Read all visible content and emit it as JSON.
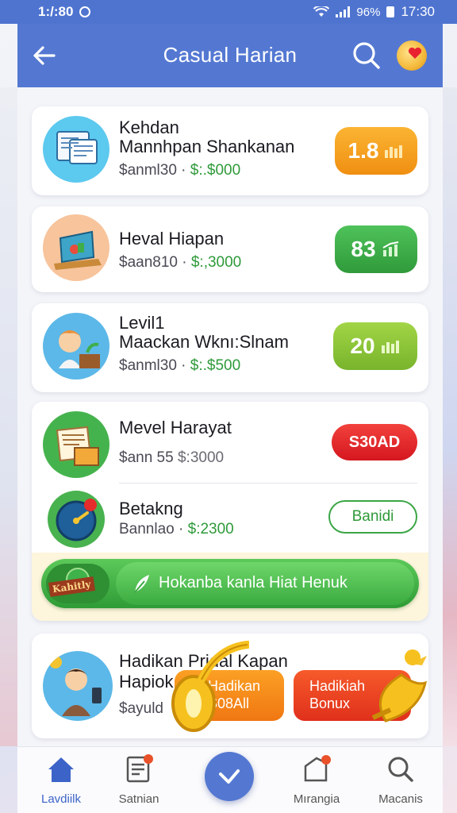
{
  "status_bar": {
    "time_left": "1:/:80",
    "battery_pct": "96%",
    "time_right": "17:30"
  },
  "header": {
    "title": "Casual Harian"
  },
  "cards": [
    {
      "title_line1": "Kehdan",
      "title_line2": "Mannhpan Shankanan",
      "sub_prefix": "$anml30 · ",
      "sub_amount": "$:.$000",
      "badge": "1.8",
      "badge_color": "#f59d1e"
    },
    {
      "title_line1": "Heval Hiapan",
      "sub_prefix": "$aan810 · ",
      "sub_amount": "$:,3000",
      "badge": "83",
      "badge_color": "#3fae4a"
    },
    {
      "title_line1": "Levil1",
      "title_line2": "Maackan Wknı:Slnam",
      "sub_prefix": "$anml30 · ",
      "sub_amount": "$:.$500",
      "badge": "20",
      "badge_color": "#8cc63e"
    }
  ],
  "card_group": {
    "row1": {
      "title": "Mevel Harayat",
      "sub_prefix": "$ann 55 ",
      "sub_amount": "$:3000",
      "badge": "S30AD",
      "badge_color": "#e52b2b"
    },
    "row2": {
      "title": "Betakng",
      "sub_prefix": "Bannlao · ",
      "sub_amount": "$:2300",
      "button": "Banidi"
    },
    "banner": {
      "tag": "Kahitly",
      "text": "Hokanba kanla Hiat Henuk"
    }
  },
  "bottom_card": {
    "title_line1": "Hadikan Pridal Kapan",
    "title_line2": "Hapiok",
    "sub_prefix": "$ayuld",
    "btn_orange_line1": "Hadikan",
    "btn_orange_line2": "S08All",
    "btn_red_line1": "Hadikiah",
    "btn_red_line2": "Bonux"
  },
  "bottom_nav": [
    {
      "label": "Lavdiilk",
      "icon": "home-icon",
      "active": true
    },
    {
      "label": "Satnian",
      "icon": "document-icon",
      "active": false
    },
    {
      "label": "",
      "icon": "check-icon",
      "active": false
    },
    {
      "label": "Mırangia",
      "icon": "folder-icon",
      "active": false
    },
    {
      "label": "Macanis",
      "icon": "search-icon",
      "active": false
    }
  ]
}
